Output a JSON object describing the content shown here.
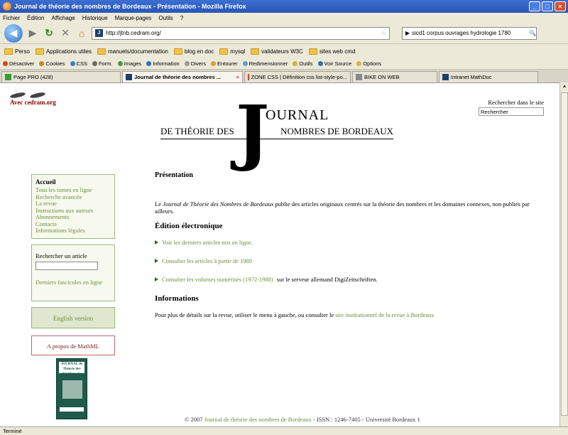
{
  "window": {
    "title": "Journal de théorie des nombres de Bordeaux - Présentation - Mozilla Firefox",
    "controls": [
      "_",
      "□",
      "×"
    ]
  },
  "menubar": [
    "Fichier",
    "Édition",
    "Affichage",
    "Historique",
    "Marque-pages",
    "Outils",
    "?"
  ],
  "navbar": {
    "url": "http://jtnb.cedram.org/",
    "search_value": "sicd1 corpus ouvrages hydrologie 1780"
  },
  "bookmarks": [
    "Perso",
    "Applications utiles",
    "manuels/documentation",
    "blog en doc",
    "mysql",
    "validateurs W3C",
    "sites web cmd"
  ],
  "devbar": [
    "Désactiver",
    "Cookies",
    "CSS",
    "Form.",
    "Images",
    "Information",
    "Divers",
    "Entourer",
    "Redimensionner",
    "Outils",
    "Voir Source",
    "Options"
  ],
  "tabs": [
    {
      "label": "Page PRO (428)",
      "active": false
    },
    {
      "label": "Journal de théorie des nombres ...",
      "active": true
    },
    {
      "label": "ZONE CSS | Définition css list-style-po...",
      "active": false
    },
    {
      "label": "BIKE ON WEB",
      "active": false
    },
    {
      "label": "Intranet MathDoc",
      "active": false
    }
  ],
  "page": {
    "cedram_link": "Avec cedram.org",
    "masthead": {
      "big_letter": "J",
      "line1": "OURNAL",
      "line2_left": "DE THÉORIE DES",
      "line2_right": "NOMBRES DE BORDEAUX"
    },
    "site_search": {
      "label": "Rechercher dans le site",
      "value": "Rechercher"
    },
    "nav": {
      "heading": "Accueil",
      "links": [
        "Tous les tomes en ligne",
        "Recherche avancée",
        "La revue",
        "Instructions aux auteurs",
        "Abonnements",
        "Contacts",
        "Informations légales"
      ]
    },
    "article_search": {
      "label": "Rechercher un article",
      "latest_link": "Derniers fascicules en ligne"
    },
    "english_button": "English version",
    "mathml_link": "A propos de MathML",
    "cover": {
      "title": "JOURNAL de Théorie des Nombres de Bordeaux"
    },
    "main": {
      "heading": "Présentation",
      "intro_pre": "Le ",
      "intro_em": "Journal de Théorie des Nombres de Bordeaux",
      "intro_post": " publie des articles originaux centrés sur la théorie des nombres et les domaines connexes, non publiés par ailleurs.",
      "edition_heading": "Édition électronique",
      "bullets": [
        {
          "link": "Voir les derniers articles mis en ligne.",
          "rest": ""
        },
        {
          "link": "Consulter les articles à partir de 1989",
          "rest": ""
        },
        {
          "link": "Consulter les volumes numérisés (1972-1988)",
          "rest": " sur le serveur allemand DigiZeitschriften."
        }
      ],
      "info_heading": "Informations",
      "info_pre": "Pour plus de détails sur la revue, utiliser le menu à gauche, ou consulter le ",
      "info_link": "site institutionnel de la revue à Bordeaux"
    },
    "footer": {
      "pre": "© 2007 ",
      "link": "Journal de théorie des nombres de Bordeaux",
      "post": " - ISSN : 1246-7405 - Université Bordeaux 1"
    }
  },
  "status": {
    "text": "Terminé"
  }
}
